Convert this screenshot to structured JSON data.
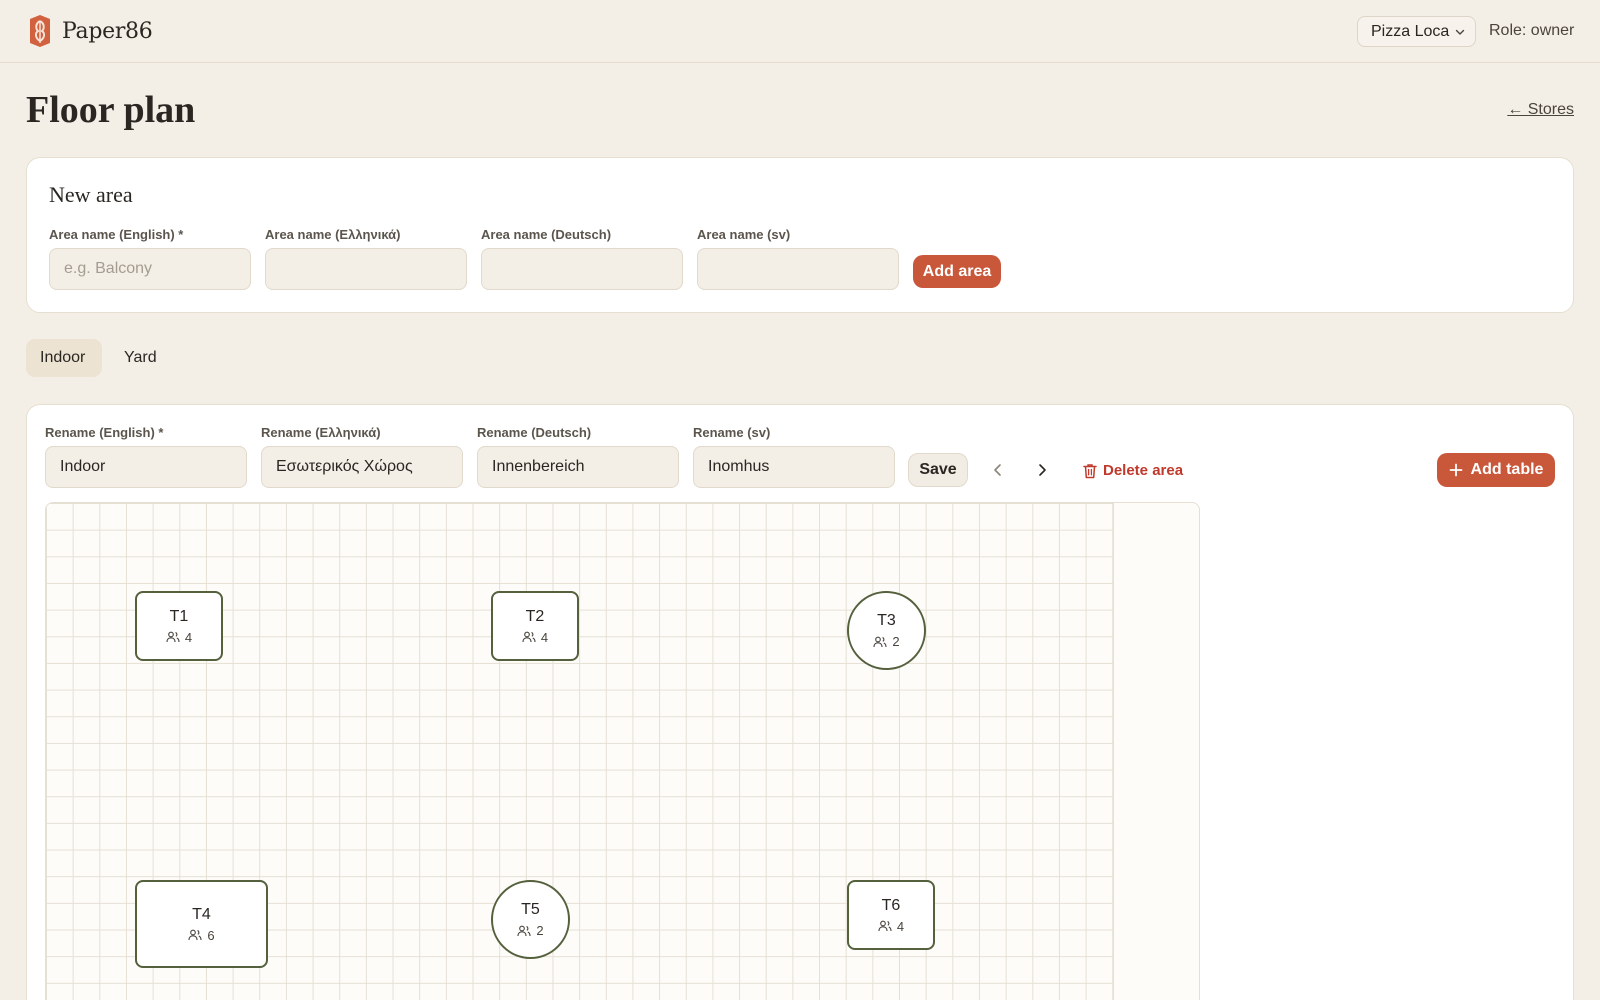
{
  "header": {
    "brand_name": "Paper86",
    "store_selected": "Pizza Loca",
    "role_text": "Role: owner"
  },
  "page": {
    "title": "Floor plan",
    "back_link": "← Stores"
  },
  "new_area": {
    "title": "New area",
    "fields": [
      {
        "label": "Area name (English) *",
        "value": "",
        "placeholder": "e.g. Balcony"
      },
      {
        "label": "Area name (Ελληνικά)",
        "value": "",
        "placeholder": ""
      },
      {
        "label": "Area name (Deutsch)",
        "value": "",
        "placeholder": ""
      },
      {
        "label": "Area name (sv)",
        "value": "",
        "placeholder": ""
      }
    ],
    "add_button": "Add area"
  },
  "tabs": [
    {
      "label": "Indoor",
      "active": true
    },
    {
      "label": "Yard",
      "active": false
    }
  ],
  "area_editor": {
    "fields": [
      {
        "label": "Rename (English) *",
        "value": "Indoor"
      },
      {
        "label": "Rename (Ελληνικά)",
        "value": "Εσωτερικός Χώρος"
      },
      {
        "label": "Rename (Deutsch)",
        "value": "Innenbereich"
      },
      {
        "label": "Rename (sv)",
        "value": "Inomhus"
      }
    ],
    "save_button": "Save",
    "delete_button": "Delete area",
    "add_table_button": "Add table"
  },
  "tables": [
    {
      "name": "T1",
      "seats": "4",
      "shape": "square"
    },
    {
      "name": "T2",
      "seats": "4",
      "shape": "square"
    },
    {
      "name": "T3",
      "seats": "2",
      "shape": "round"
    },
    {
      "name": "T4",
      "seats": "6",
      "shape": "square"
    },
    {
      "name": "T5",
      "seats": "2",
      "shape": "round"
    },
    {
      "name": "T6",
      "seats": "4",
      "shape": "square"
    }
  ],
  "colors": {
    "accent": "#c9583a",
    "background": "#f4efe6",
    "table_border": "#55613d",
    "danger": "#c0392b"
  }
}
